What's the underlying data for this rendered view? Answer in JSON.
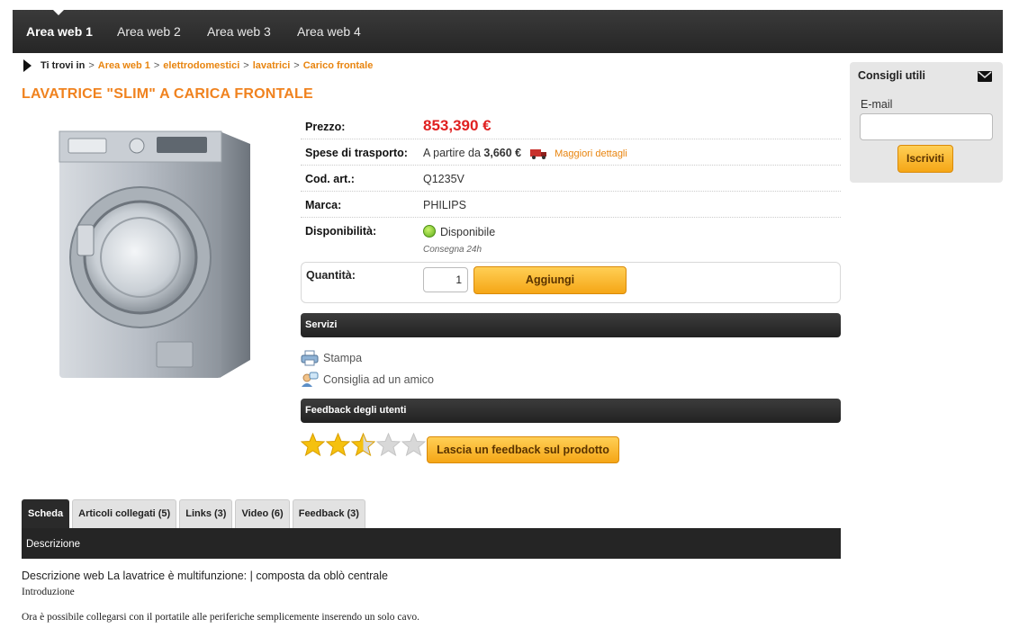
{
  "nav": {
    "items": [
      "Area web 1",
      "Area web 2",
      "Area web 3",
      "Area web 4"
    ]
  },
  "breadcrumb": {
    "prefix": "Ti trovi in",
    "links": [
      "Area web 1",
      "elettrodomestici",
      "lavatrici",
      "Carico frontale"
    ],
    "separator": ">"
  },
  "product": {
    "title": "LAVATRICE \"SLIM\" A CARICA FRONTALE",
    "image_alt": "washing-machine",
    "price_label": "Prezzo:",
    "price": "853,390 €",
    "shipping_label": "Spese di trasporto:",
    "shipping_prefix": "A partire da",
    "shipping_value": "3,660 €",
    "shipping_link": "Maggiori dettagli",
    "code_label": "Cod. art.:",
    "code": "Q1235V",
    "brand_label": "Marca:",
    "brand": "PHILIPS",
    "availability_label": "Disponibilità:",
    "availability": "Disponibile",
    "delivery_note": "Consegna 24h",
    "quantity_label": "Quantità:",
    "quantity": "1",
    "add_button": "Aggiungi"
  },
  "services": {
    "header": "Servizi",
    "print": "Stampa",
    "recommend": "Consiglia ad un amico"
  },
  "feedback": {
    "header": "Feedback degli utenti",
    "rating": 2.5,
    "rating_max": 5,
    "button": "Lascia un feedback sul prodotto"
  },
  "sidebar": {
    "title": "Consigli utili",
    "email_label": "E-mail",
    "email_value": "",
    "subscribe": "Iscriviti"
  },
  "tabs": [
    "Scheda",
    "Articoli collegati (5)",
    "Links (3)",
    "Video (6)",
    "Feedback (3)"
  ],
  "tab_panel": {
    "title": "Descrizione"
  },
  "description": {
    "line1": "Descrizione web La lavatrice è multifunzione: | composta da oblò centrale",
    "line2": "Introduzione",
    "line3": "Ora è possibile collegarsi con il portatile alle periferiche semplicemente inserendo un solo cavo."
  },
  "colors": {
    "accent": "#f0821e",
    "price": "#e02020",
    "available": "#2e9a2e",
    "button": "#f5a616"
  }
}
